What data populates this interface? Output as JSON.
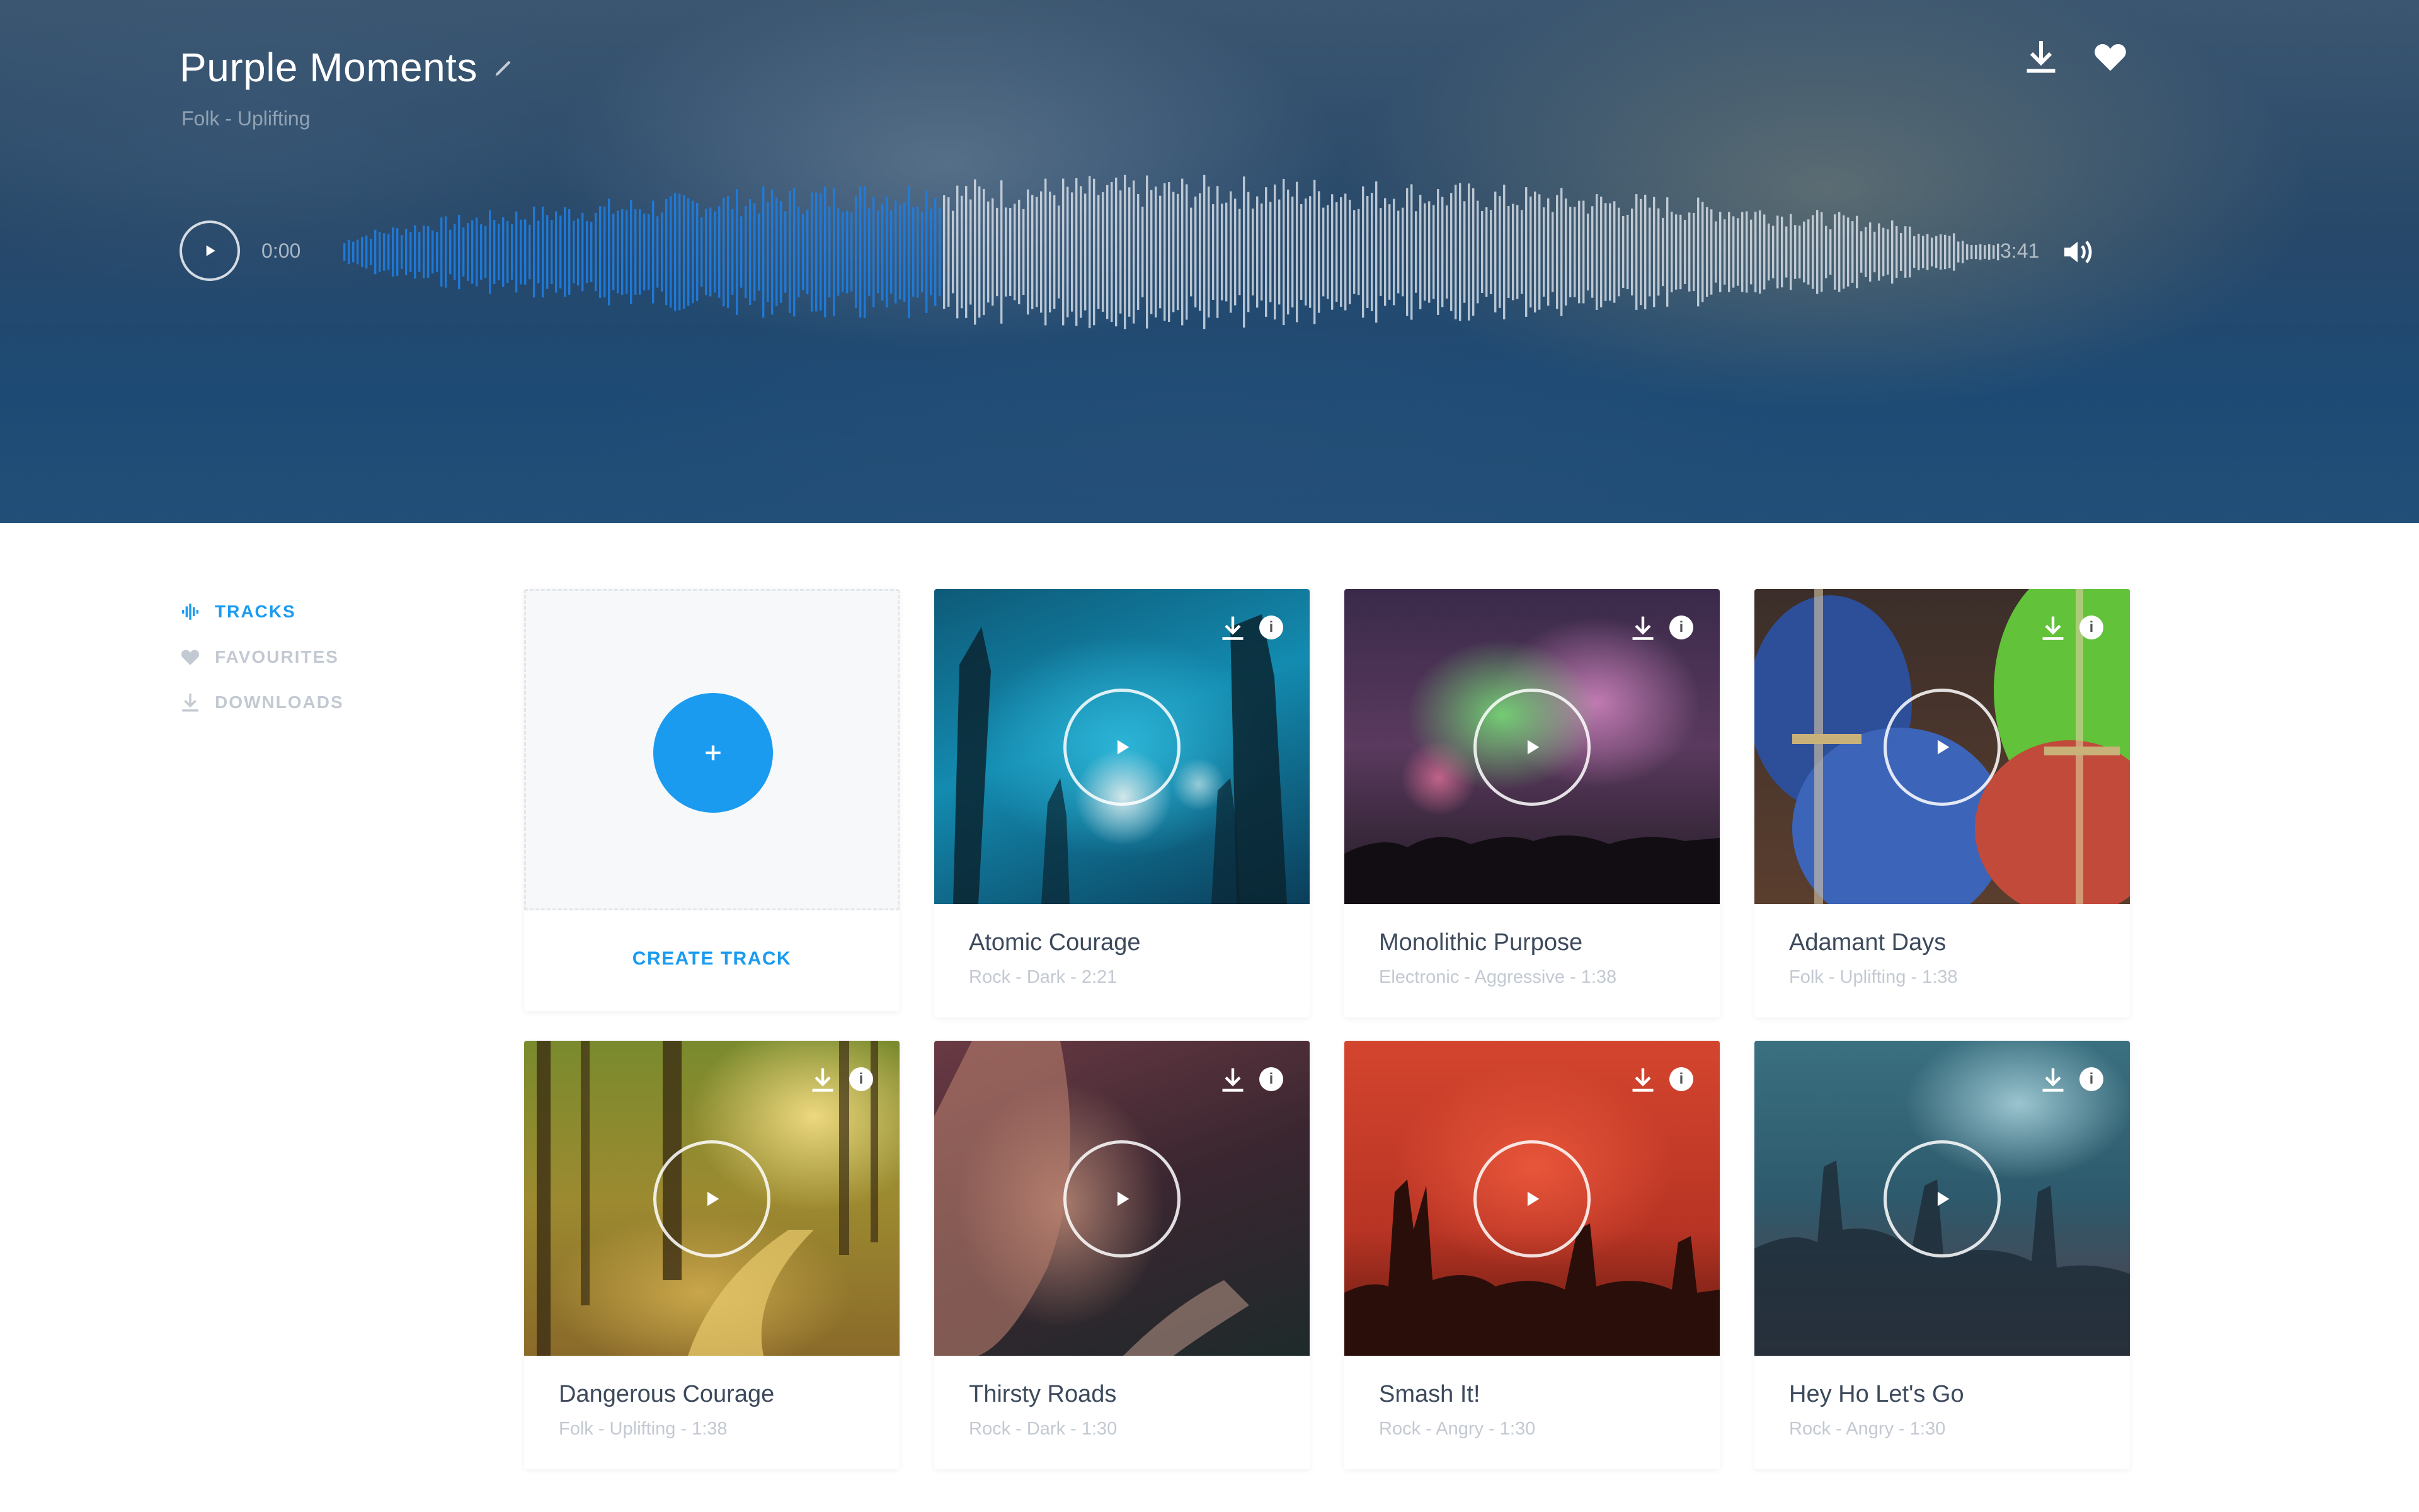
{
  "hero": {
    "title": "Purple Moments",
    "subtitle": "Folk - Uplifting",
    "time_current": "0:00",
    "time_total": "3:41",
    "progress_fraction": 0.36
  },
  "sidebar": {
    "items": [
      {
        "label": "TRACKS",
        "icon": "waveform-icon",
        "active": true
      },
      {
        "label": "FAVOURITES",
        "icon": "heart-icon",
        "active": false
      },
      {
        "label": "DOWNLOADS",
        "icon": "download-icon",
        "active": false
      }
    ]
  },
  "create": {
    "label": "CREATE TRACK"
  },
  "tracks": [
    {
      "title": "Atomic Courage",
      "meta": "Rock - Dark - 2:21"
    },
    {
      "title": "Monolithic Purpose",
      "meta": "Electronic - Aggressive - 1:38"
    },
    {
      "title": "Adamant Days",
      "meta": "Folk - Uplifting - 1:38"
    },
    {
      "title": "Dangerous Courage",
      "meta": "Folk - Uplifting - 1:38"
    },
    {
      "title": "Thirsty Roads",
      "meta": "Rock - Dark - 1:30"
    },
    {
      "title": "Smash It!",
      "meta": "Rock - Angry - 1:30"
    },
    {
      "title": "Hey Ho Let's Go",
      "meta": "Rock - Angry - 1:30"
    }
  ],
  "colors": {
    "accent": "#1a9bf0",
    "wave_played": "#1f7de0",
    "wave_unplayed": "#e8eef4"
  }
}
